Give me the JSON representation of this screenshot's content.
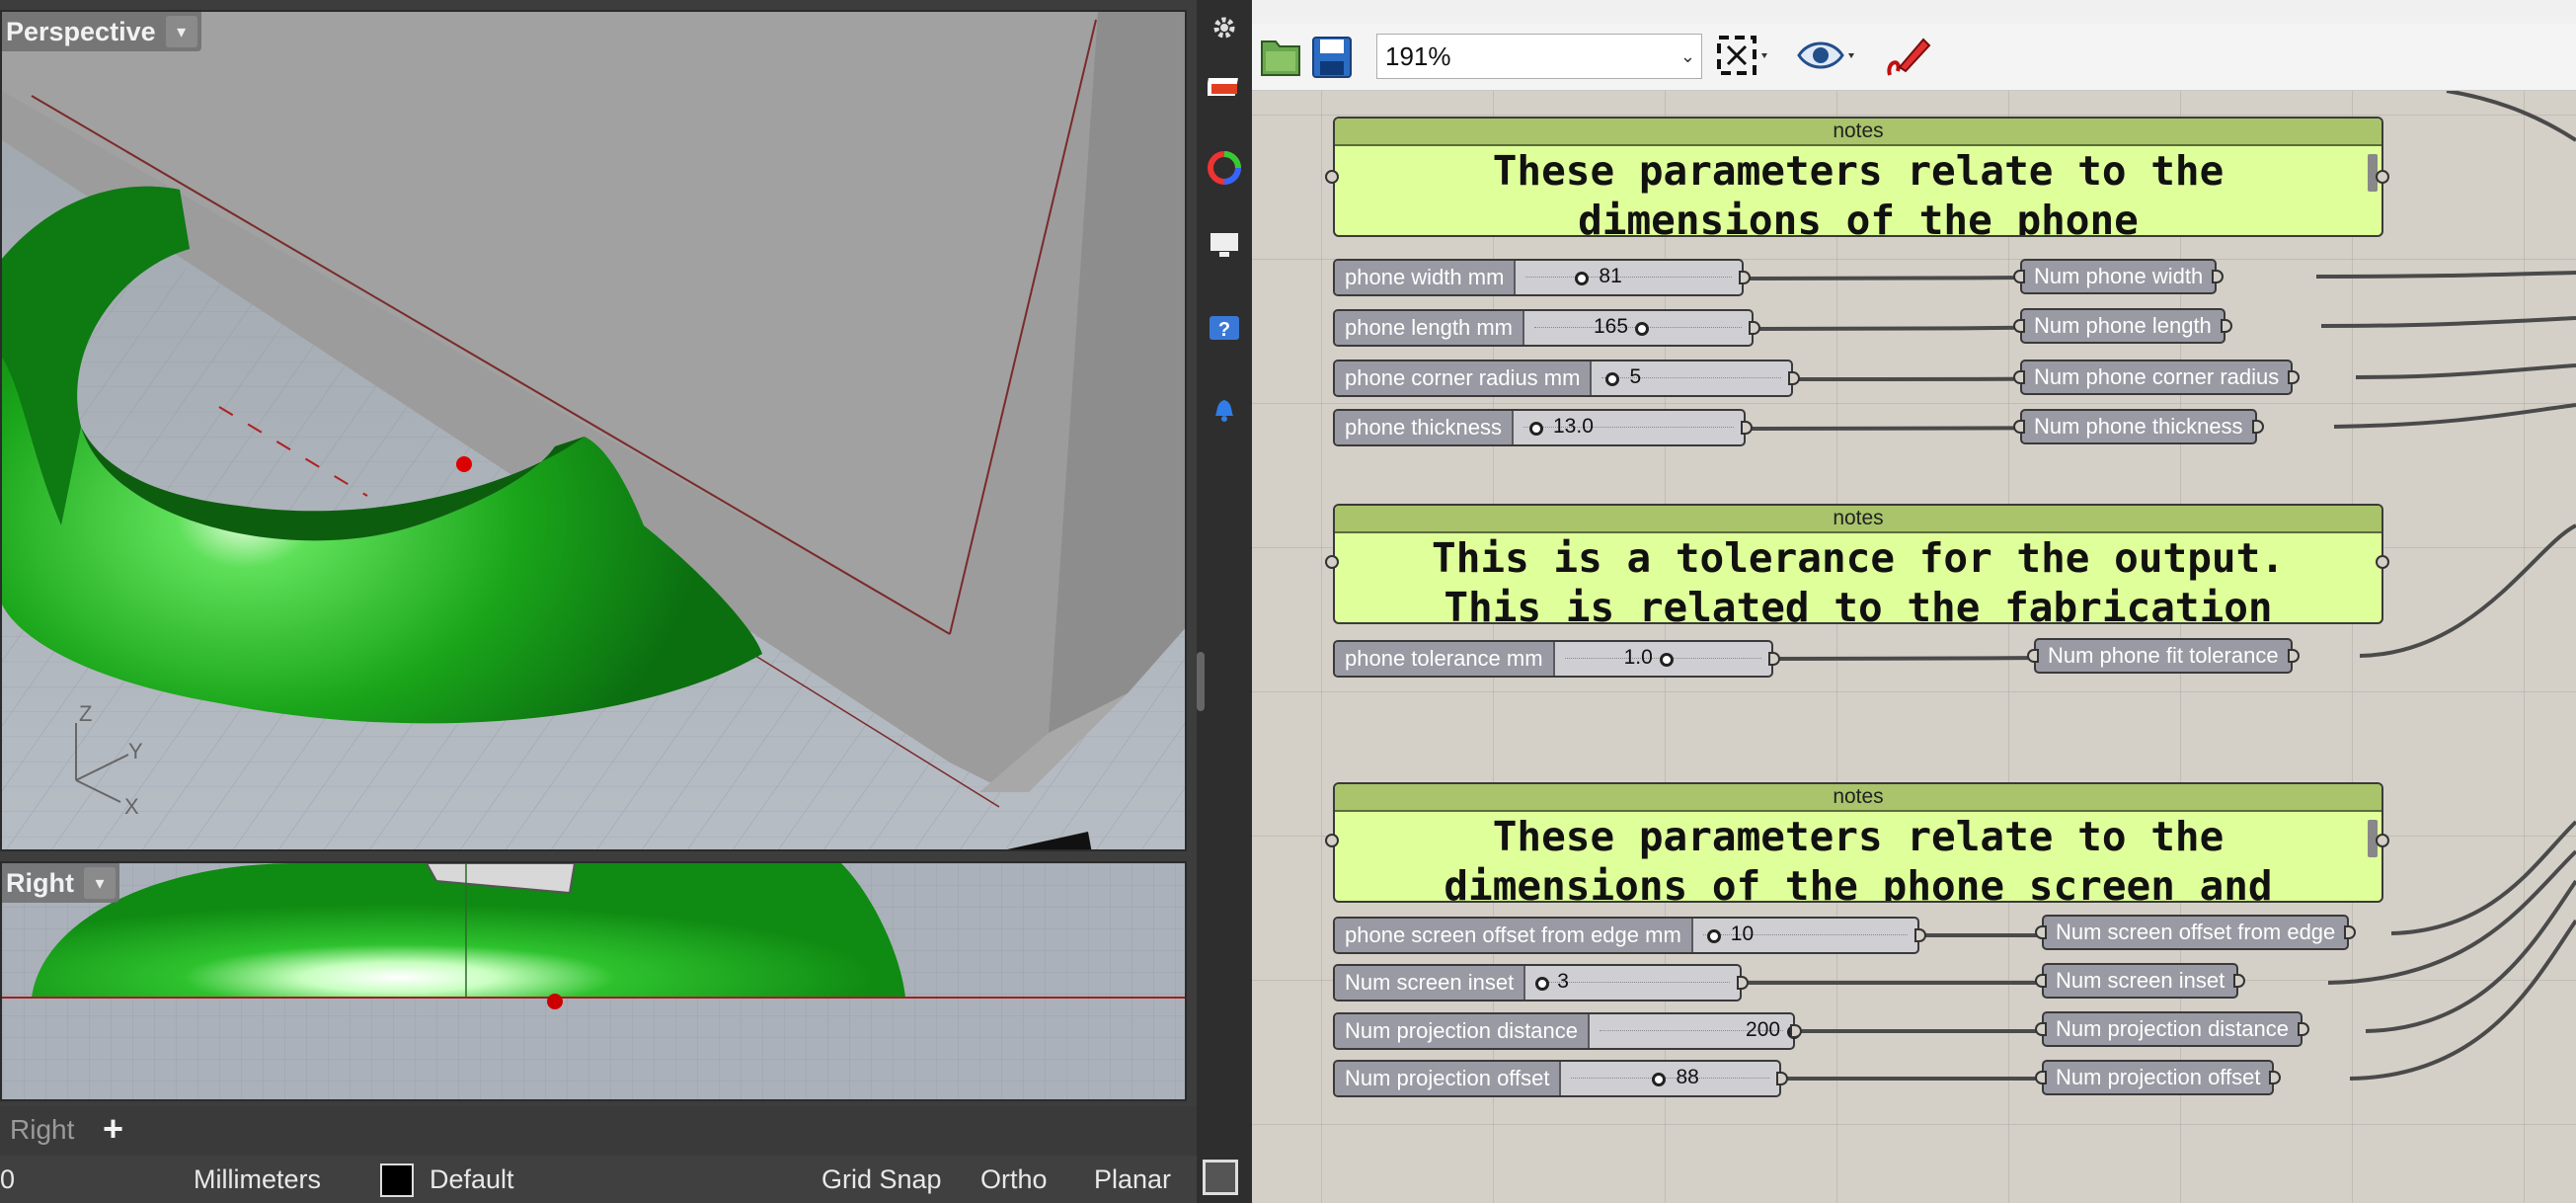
{
  "rhino": {
    "viewports": {
      "perspective_label": "Perspective",
      "right_label": "Right"
    },
    "axes": {
      "z": "Z",
      "y": "Y",
      "x": "X"
    },
    "tabs": {
      "active": "Right",
      "add": "+"
    },
    "status": {
      "coord": "0",
      "units": "Millimeters",
      "layer": "Default",
      "grid_snap": "Grid Snap",
      "ortho": "Ortho",
      "planar": "Planar"
    },
    "toolbar_icons": [
      "gear-icon",
      "layers-icon",
      "color-wheel-icon",
      "display-icon",
      "help-icon",
      "notification-bell-icon"
    ]
  },
  "grasshopper": {
    "zoom": "191%",
    "toolbar_icons": [
      "open-file-icon",
      "save-file-icon",
      "zoom-extents-icon",
      "preview-eye-icon",
      "sketch-pen-icon"
    ],
    "notes": [
      {
        "header": "notes",
        "line1": "These parameters relate to the",
        "line2": "dimensions of the phone"
      },
      {
        "header": "notes",
        "line1": "This is a tolerance for the output.",
        "line2": "This is related to the fabrication"
      },
      {
        "header": "notes",
        "line1": "These parameters relate to the",
        "line2": "dimensions of the phone screen and"
      }
    ],
    "sliders": [
      {
        "label": "phone width mm",
        "value": "81"
      },
      {
        "label": "phone length mm",
        "value": "165"
      },
      {
        "label": "phone corner radius mm",
        "value": "5"
      },
      {
        "label": "phone thickness",
        "value": "13.0"
      },
      {
        "label": "phone tolerance mm",
        "value": "1.0"
      },
      {
        "label": "phone  screen offset from edge mm",
        "value": "10"
      },
      {
        "label": "Num screen inset",
        "value": "3"
      },
      {
        "label": "Num projection distance",
        "value": "200"
      },
      {
        "label": "Num projection offset",
        "value": "88"
      }
    ],
    "params": [
      "Num phone width",
      "Num phone length",
      "Num phone corner radius",
      "Num phone thickness",
      "Num phone fit tolerance",
      "Num screen offset from edge",
      "Num screen inset",
      "Num projection distance",
      "Num projection offset"
    ],
    "colors": {
      "note_bg": "#dfff9a",
      "note_header": "#a9c46a",
      "component": "#9a9aa4",
      "canvas": "#d4d0c8"
    }
  }
}
